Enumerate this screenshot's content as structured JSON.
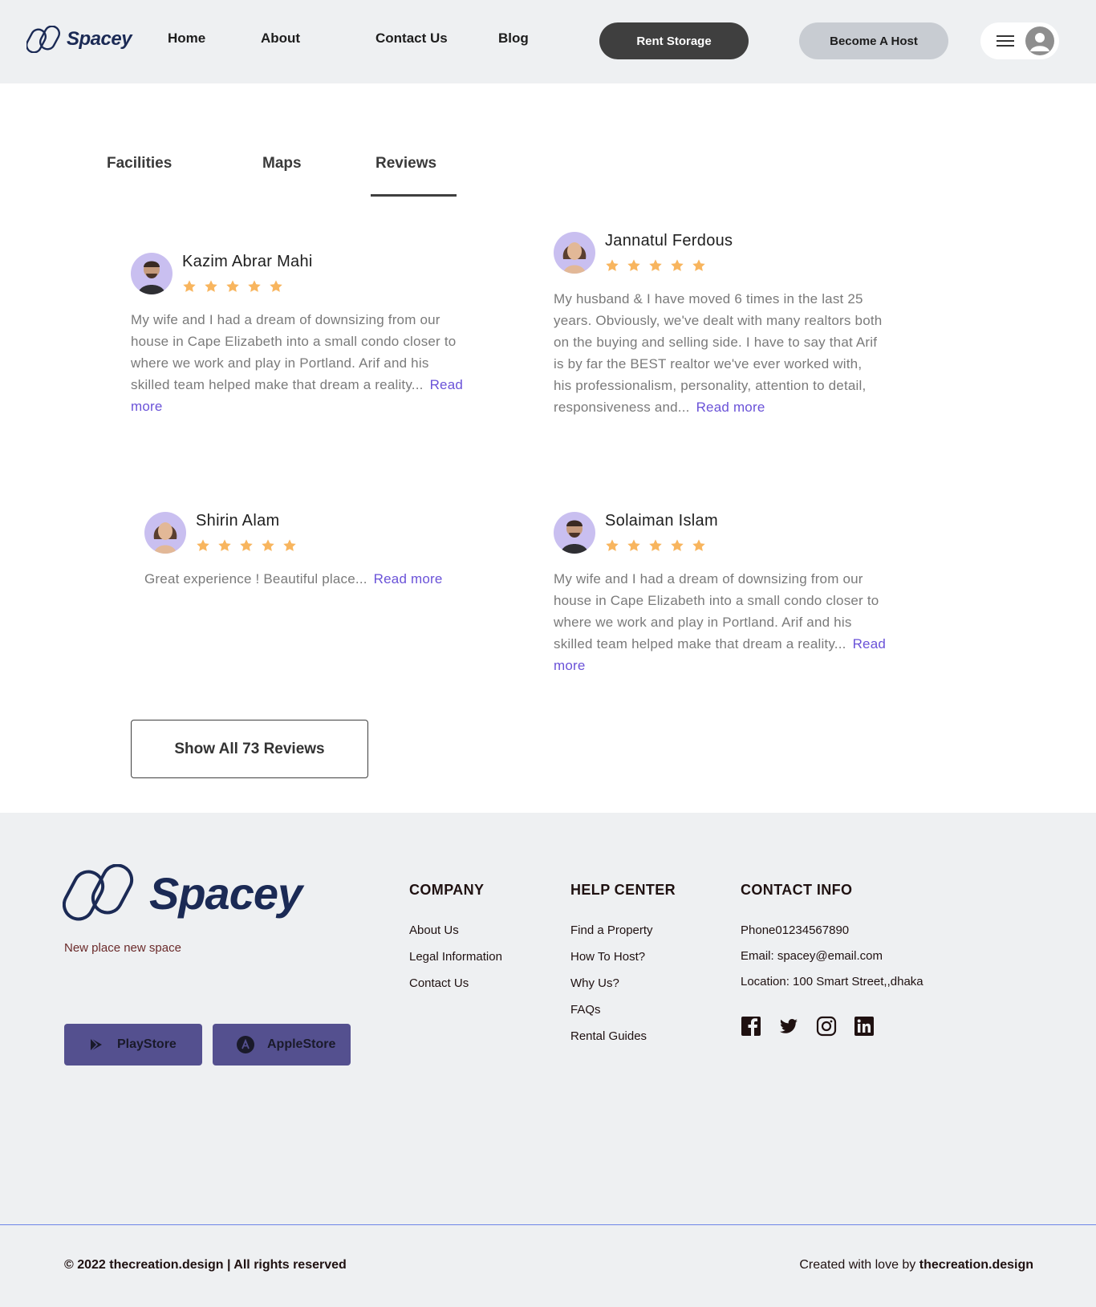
{
  "header": {
    "logo_text": "Spacey",
    "nav": [
      "Home",
      "About",
      "Contact Us",
      "Blog"
    ],
    "rent_storage": "Rent Storage",
    "become_host": "Become A Host",
    "menu_icon": "hamburger-icon",
    "avatar_icon": "user-avatar-icon"
  },
  "tabs": [
    "Facilities",
    "Maps",
    "Reviews"
  ],
  "active_tab": "Reviews",
  "reviews": [
    {
      "name": "Kazim Abrar Mahi",
      "rating": 5,
      "text": "My wife and I had a dream of downsizing from our house in Cape Elizabeth into a small condo closer to where we work and play in Portland. Arif and his skilled team helped make that dream a reality...",
      "read_more": "Read more"
    },
    {
      "name": "Jannatul Ferdous",
      "rating": 5,
      "text": "My husband & I have moved 6 times in the last 25 years. Obviously, we've dealt with many realtors both on the buying and selling side. I have to say that Arif is by far the BEST realtor we've ever worked with, his professionalism, personality, attention to detail, responsiveness and...",
      "read_more": "Read more"
    },
    {
      "name": "Shirin Alam",
      "rating": 5,
      "text": "Great experience ! Beautiful place...",
      "read_more": "Read more"
    },
    {
      "name": "Solaiman Islam",
      "rating": 5,
      "text": "My wife and I had a dream of downsizing from our house in Cape Elizabeth into a small condo closer to where we work and play in Portland. Arif and his skilled team helped make that dream a reality...",
      "read_more": "Read more"
    }
  ],
  "show_all": "Show All 73 Reviews",
  "footer": {
    "logo_text": "Spacey",
    "tagline": "New place new  space",
    "playstore": "PlayStore",
    "applestore": "AppleStore",
    "company": {
      "title": "COMPANY",
      "links": [
        "About Us",
        "Legal Information",
        "Contact Us"
      ]
    },
    "help": {
      "title": "HELP CENTER",
      "links": [
        "Find a Property",
        "How To Host?",
        "Why Us?",
        "FAQs",
        "Rental Guides"
      ]
    },
    "contact": {
      "title": "CONTACT INFO",
      "phone": "Phone01234567890",
      "email": "Email: spacey@email.com",
      "location": "Location: 100 Smart Street,,dhaka"
    },
    "social": [
      "facebook-icon",
      "twitter-icon",
      "instagram-icon",
      "linkedin-icon"
    ],
    "copyright": "© 2022 thecreation.design | All rights reserved",
    "credits_prefix": "Created with love by ",
    "credits_brand": "thecreation.design"
  },
  "colors": {
    "header_bg": "#eef0f2",
    "brand_navy": "#1b2a55",
    "star": "#f8b55e",
    "link": "#6a52d8",
    "store_btn": "#54508f"
  }
}
